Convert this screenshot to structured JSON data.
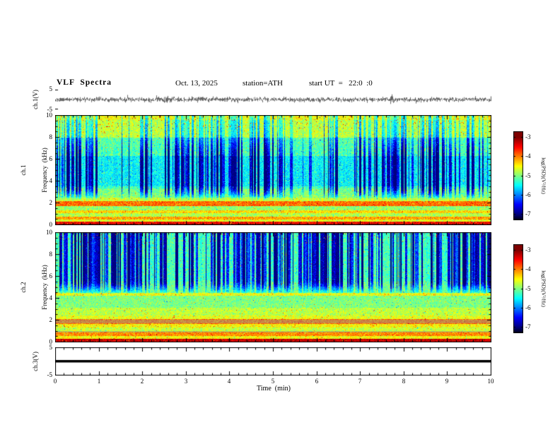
{
  "header": {
    "title": "VLF  Spectra",
    "date": "Oct. 13, 2025",
    "station": "station=ATH",
    "start_ut": "start UT  =   22:0  :0"
  },
  "time_axis": {
    "label": "Time  (min)",
    "ticks": [
      0,
      1,
      2,
      3,
      4,
      5,
      6,
      7,
      8,
      9,
      10
    ],
    "range": [
      0,
      10
    ]
  },
  "colorbar": {
    "label": "log(PSD)(V²/Hz)",
    "ticks": [
      -3,
      -4,
      -5,
      -6,
      -7
    ],
    "zlim": [
      -7,
      -3
    ],
    "value_top": -2.7,
    "value_bottom": -7.3
  },
  "panels": {
    "ch1_wave": {
      "ylabel": "ch.1(V)",
      "ylim": [
        -5,
        5
      ],
      "ytick_labels": [
        5,
        -5
      ]
    },
    "ch1_spec": {
      "ylabel_line1": "ch.1",
      "ylabel_line2": "Frequency  (kHz)",
      "ylim": [
        0,
        10
      ],
      "yticks": [
        10,
        8,
        6,
        4,
        2,
        0
      ]
    },
    "ch2_spec": {
      "ylabel_line1": "ch.2",
      "ylabel_line2": "Frequency  (kHz)",
      "ylim": [
        0,
        10
      ],
      "yticks": [
        10,
        8,
        6,
        4,
        2,
        0
      ]
    },
    "ch3_wave": {
      "ylabel": "ch.3(V)",
      "ylim": [
        -5,
        5
      ],
      "ytick_labels": [
        5,
        -5
      ]
    }
  },
  "chart_data": [
    {
      "type": "line",
      "name": "ch.1 voltage waveform",
      "xlabel": "Time (min)",
      "xlim": [
        0,
        10
      ],
      "ylabel": "ch.1(V)",
      "ylim": [
        -5,
        5
      ],
      "signal": "broadband noise centered on 0 V, typical excursions ±2 V with sporadic spikes to ±4 V",
      "seed": 20251013
    },
    {
      "type": "heatmap",
      "name": "ch.1 VLF spectrogram",
      "xlabel": "Time (min)",
      "xlim": [
        0,
        10
      ],
      "ylabel": "Frequency (kHz)",
      "ylim": [
        0,
        10
      ],
      "zlabel": "log(PSD)(V^2/Hz)",
      "zlim": [
        -7,
        -3
      ],
      "colormap": "jet",
      "seed": 42,
      "noise": 0.16,
      "speckle_prob": 0.05,
      "streak_prob": 0.27,
      "streak_mask": [
        [
          0,
          0
        ],
        [
          2.2,
          0
        ],
        [
          3.2,
          1
        ],
        [
          6.5,
          1
        ],
        [
          8.2,
          0.55
        ],
        [
          10,
          0.45
        ]
      ],
      "bands": [
        [
          0,
          0.12,
          0.96
        ],
        [
          0.12,
          0.3,
          0.88
        ],
        [
          0.3,
          0.5,
          0.6
        ],
        [
          0.5,
          0.75,
          0.72
        ],
        [
          0.75,
          1.05,
          0.55
        ],
        [
          1.05,
          1.35,
          0.66
        ],
        [
          1.35,
          1.7,
          0.52
        ],
        [
          1.7,
          2.15,
          0.77
        ],
        [
          2.15,
          2.5,
          0.58
        ],
        [
          2.5,
          3.3,
          0.52
        ],
        [
          3.3,
          3.5,
          0.47
        ],
        [
          3.5,
          6.3,
          0.4
        ],
        [
          6.3,
          8,
          0.48
        ],
        [
          8,
          9.6,
          0.58
        ],
        [
          9.6,
          10,
          0.63
        ]
      ],
      "top_speck": {
        "fmin": 8.8,
        "prob": 0.02,
        "level": 0.82
      },
      "gray_bands": []
    },
    {
      "type": "heatmap",
      "name": "ch.2 VLF spectrogram",
      "xlabel": "Time (min)",
      "xlim": [
        0,
        10
      ],
      "ylabel": "Frequency (kHz)",
      "ylim": [
        0,
        10
      ],
      "zlabel": "log(PSD)(V^2/Hz)",
      "zlim": [
        -7,
        -3
      ],
      "colormap": "jet",
      "seed": 1337,
      "noise": 0.15,
      "speckle_prob": 0.05,
      "streak_prob": 0.32,
      "streak_mask": [
        [
          0,
          0
        ],
        [
          4.3,
          0
        ],
        [
          5.4,
          1
        ],
        [
          10,
          1
        ]
      ],
      "bands": [
        [
          0,
          0.12,
          0.9
        ],
        [
          0.12,
          0.32,
          0.93
        ],
        [
          0.32,
          0.55,
          0.62
        ],
        [
          0.55,
          0.95,
          0.74
        ],
        [
          0.95,
          1.3,
          0.57
        ],
        [
          1.3,
          1.65,
          0.63
        ],
        [
          1.65,
          2.1,
          0.76
        ],
        [
          2.1,
          2.45,
          0.6
        ],
        [
          2.45,
          3.1,
          0.56
        ],
        [
          3.1,
          4.2,
          0.5
        ],
        [
          4.2,
          4.5,
          0.62
        ],
        [
          4.5,
          5.5,
          0.5
        ],
        [
          5.5,
          10,
          0.47
        ]
      ],
      "top_speck": {
        "fmin": 9.0,
        "prob": 0.012,
        "level": 0.8
      },
      "gray_bands": [
        [
          0.85,
          1.0,
          0.45
        ],
        [
          1.7,
          2.05,
          0.5
        ]
      ]
    },
    {
      "type": "line",
      "name": "ch.3 voltage waveform",
      "xlabel": "Time (min)",
      "xlim": [
        0,
        10
      ],
      "ylabel": "ch.3(V)",
      "ylim": [
        -5,
        5
      ],
      "x": [
        0,
        10
      ],
      "y": [
        0,
        0
      ],
      "signal": "constant 0 V (flat thick line)"
    }
  ]
}
